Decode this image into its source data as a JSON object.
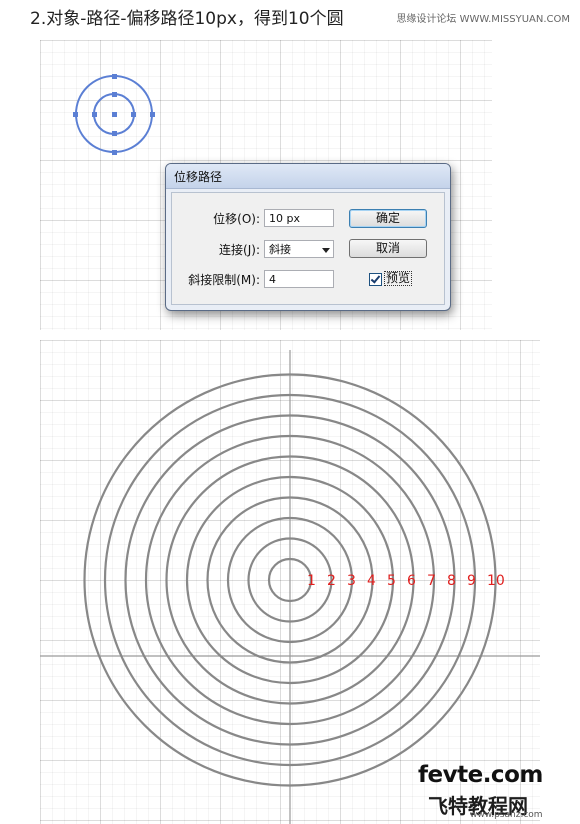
{
  "header": {
    "title": "2.对象-路径-偏移路径10px，得到10个圆",
    "watermark": "思缘设计论坛 WWW.MISSYUAN.COM"
  },
  "dialog": {
    "title": "位移路径",
    "offset": {
      "label": "位移(O):",
      "value": "10 px"
    },
    "joins": {
      "label": "连接(J):",
      "value": "斜接"
    },
    "miter_limit": {
      "label": "斜接限制(M):",
      "value": "4"
    },
    "ok_label": "确定",
    "cancel_label": "取消",
    "preview": {
      "label": "预览",
      "checked": true
    }
  },
  "colors": {
    "selection_path": "#5b7fd4",
    "ring_stroke": "#888888",
    "number_color": "#e0201f"
  },
  "rings": {
    "count": 10,
    "labels": [
      "1",
      "2",
      "3",
      "4",
      "5",
      "6",
      "7",
      "8",
      "9",
      "10"
    ]
  },
  "footer": {
    "brand": "fevte.com",
    "brand_sub": "飞特教程网",
    "url": "www.psahz.com"
  }
}
